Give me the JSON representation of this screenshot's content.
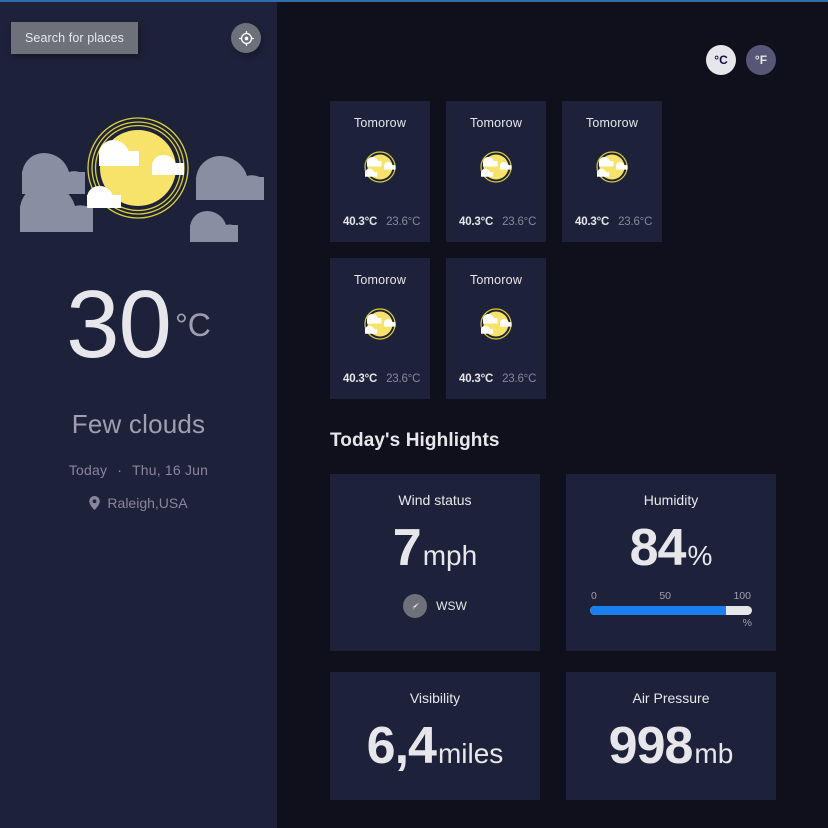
{
  "theme": {
    "sidebar_bg": "#1e213a",
    "main_bg": "#100f1c",
    "card_bg": "#1e213a",
    "accent_blue": "#1c7ff0",
    "text_primary": "#e7e7eb",
    "text_muted": "#88869d",
    "sun_yellow": "#f7e36a",
    "cloud_gray": "#8a8ea3",
    "chip_gray": "#6e707a"
  },
  "sidebar": {
    "search_button_label": "Search for places",
    "geolocate_icon": "crosshair-location-icon",
    "illustration_icon": "sun-with-clouds-illustration",
    "current": {
      "temperature": "30",
      "unit": "°C",
      "condition": "Few clouds",
      "day_label": "Today",
      "separator": "·",
      "date": "Thu, 16 Jun",
      "location_icon": "map-pin-icon",
      "location": "Raleigh,USA"
    }
  },
  "main": {
    "unit_toggle": [
      {
        "label": "°C",
        "active": true,
        "name": "celsius-toggle"
      },
      {
        "label": "°F",
        "active": false,
        "name": "fahrenheit-toggle"
      }
    ],
    "forecast": [
      {
        "day": "Tomorow",
        "icon": "sun-behind-cloud-icon",
        "max": "40.3°C",
        "min": "23.6°C"
      },
      {
        "day": "Tomorow",
        "icon": "sun-behind-cloud-icon",
        "max": "40.3°C",
        "min": "23.6°C"
      },
      {
        "day": "Tomorow",
        "icon": "sun-behind-cloud-icon",
        "max": "40.3°C",
        "min": "23.6°C"
      },
      {
        "day": "Tomorow",
        "icon": "sun-behind-cloud-icon",
        "max": "40.3°C",
        "min": "23.6°C"
      },
      {
        "day": "Tomorow",
        "icon": "sun-behind-cloud-icon",
        "max": "40.3°C",
        "min": "23.6°C"
      }
    ],
    "highlights_title": "Today's Highlights",
    "highlights": {
      "wind": {
        "label": "Wind status",
        "value": "7",
        "unit": "mph",
        "direction": "WSW",
        "direction_icon": "navigation-arrow-icon"
      },
      "humidity": {
        "label": "Humidity",
        "value": "84",
        "unit": "%",
        "bar_min": "0",
        "bar_mid": "50",
        "bar_max": "100",
        "bar_suffix": "%",
        "bar_percent": 84
      },
      "visibility": {
        "label": "Visibility",
        "value": "6,4",
        "unit": "miles"
      },
      "air_pressure": {
        "label": "Air Pressure",
        "value": "998",
        "unit": "mb"
      }
    }
  }
}
